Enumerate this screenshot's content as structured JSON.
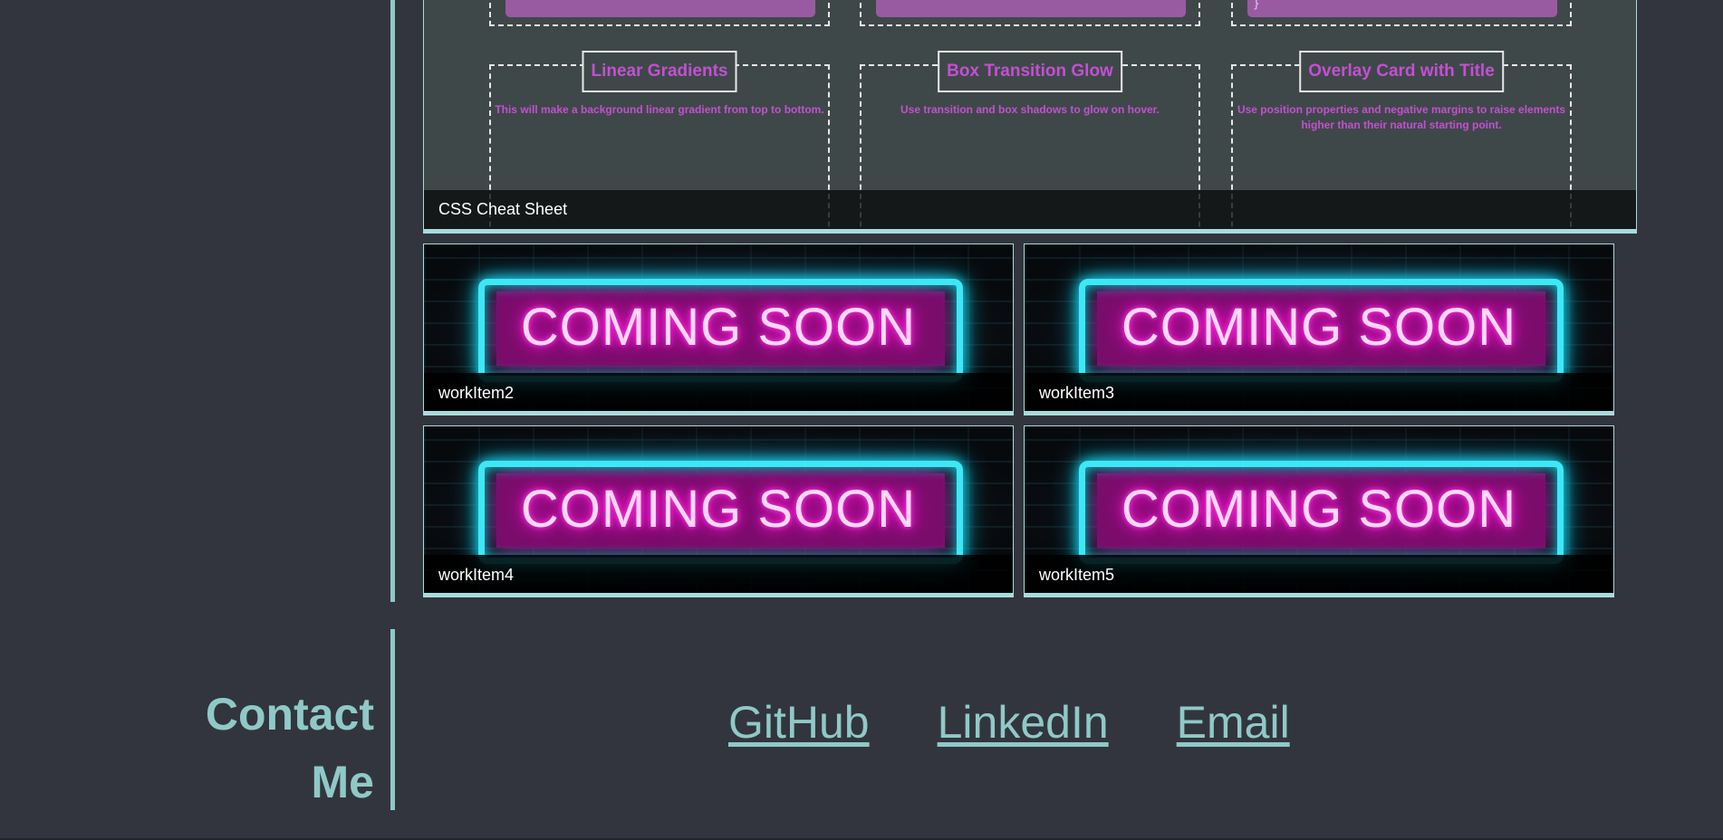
{
  "colors": {
    "page_background": "#32353e",
    "accent_teal": "#8fc9c7",
    "cheat_purple": "#c44fd3",
    "neon_cyan": "#3fe7f5",
    "neon_pink": "#ff1fd8"
  },
  "work": {
    "featured": {
      "caption": "CSS Cheat Sheet",
      "cards": [
        {
          "title": "Linear Gradients",
          "description": "This will make a background linear gradient from top to bottom."
        },
        {
          "title": "Box Transition Glow",
          "description": "Use transition and box shadows to glow on hover."
        },
        {
          "title": "Overlay Card with Title",
          "description": "Use position properties and negative margins to raise elements higher than their natural starting point."
        }
      ],
      "code_brace": "}"
    },
    "tiles": [
      {
        "caption": "workItem2",
        "image_text": "COMING SOON"
      },
      {
        "caption": "workItem3",
        "image_text": "COMING SOON"
      },
      {
        "caption": "workItem4",
        "image_text": "COMING SOON"
      },
      {
        "caption": "workItem5",
        "image_text": "COMING SOON"
      }
    ]
  },
  "contact": {
    "heading_line1": "Contact",
    "heading_line2": "Me",
    "links": [
      {
        "label": "GitHub"
      },
      {
        "label": "LinkedIn"
      },
      {
        "label": "Email"
      }
    ]
  }
}
